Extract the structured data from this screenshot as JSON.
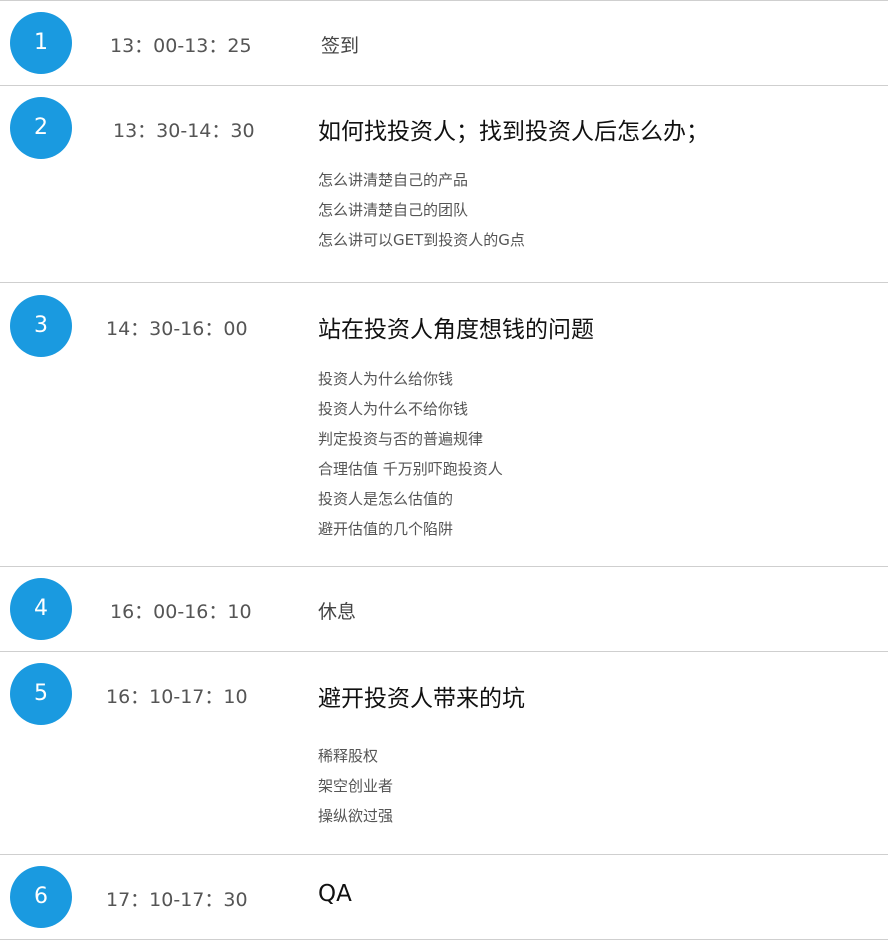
{
  "colors": {
    "badge": "#1a9ae0",
    "divider": "#cfcfcf"
  },
  "sessions": [
    {
      "number": "1",
      "time": "13：00-13：25",
      "title": "签到",
      "items": []
    },
    {
      "number": "2",
      "time": "13：30-14：30",
      "title": "如何找投资人；找到投资人后怎么办；",
      "items": [
        "怎么讲清楚自己的产品",
        "怎么讲清楚自己的团队",
        "怎么讲可以GET到投资人的G点"
      ]
    },
    {
      "number": "3",
      "time": "14：30-16：00",
      "title": "站在投资人角度想钱的问题",
      "items": [
        "投资人为什么给你钱",
        "投资人为什么不给你钱",
        "判定投资与否的普遍规律",
        "合理估值 千万别吓跑投资人",
        "投资人是怎么估值的",
        "避开估值的几个陷阱"
      ]
    },
    {
      "number": "4",
      "time": "16：00-16：10",
      "title": "休息",
      "items": []
    },
    {
      "number": "5",
      "time": "16：10-17：10",
      "title": "避开投资人带来的坑",
      "items": [
        "稀释股权",
        "架空创业者",
        "操纵欲过强"
      ]
    },
    {
      "number": "6",
      "time": "17：10-17：30",
      "title": "QA",
      "items": []
    }
  ]
}
